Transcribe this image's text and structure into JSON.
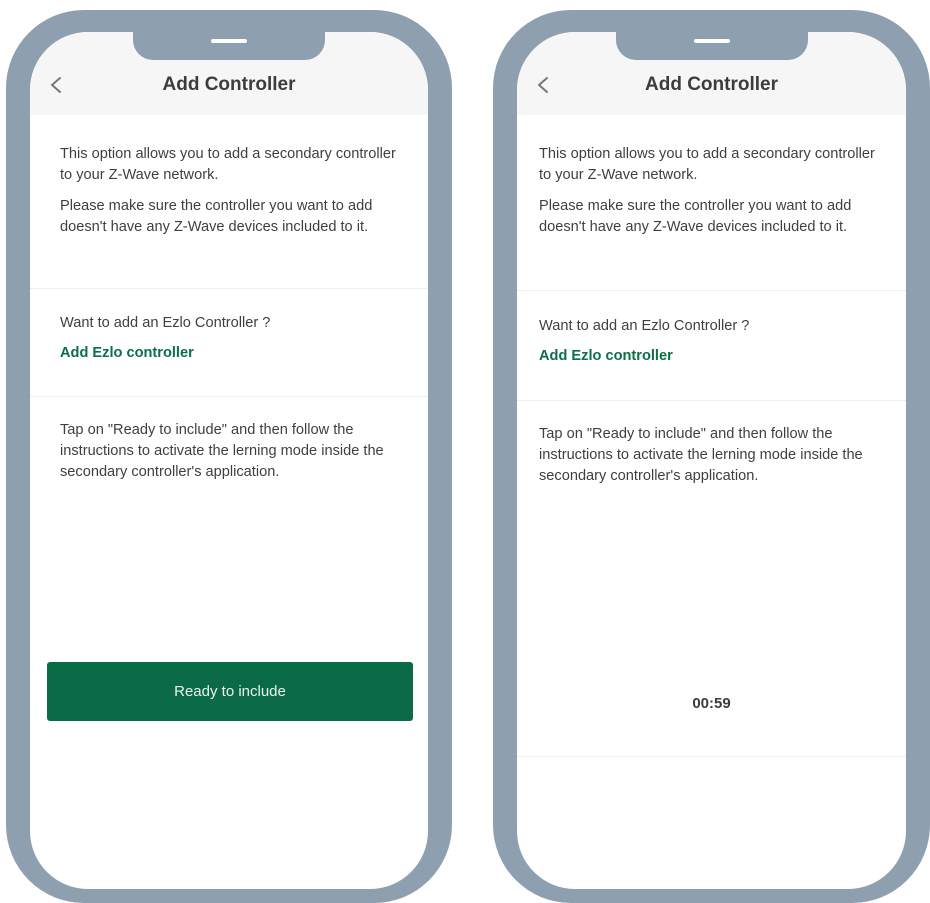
{
  "screens": [
    {
      "title": "Add Controller",
      "intro": [
        "This option allows you to add a secondary controller to your Z-Wave network.",
        "Please make sure  the controller you want to add doesn't have any Z-Wave devices included to it."
      ],
      "ezlo_question": "Want to add an Ezlo Controller ?",
      "ezlo_link": "Add Ezlo controller",
      "instructions": "Tap on \"Ready to include\" and then follow the instructions to activate the lerning mode inside the secondary controller's application.",
      "ready_button": "Ready to include"
    },
    {
      "title": "Add Controller",
      "intro": [
        "This option allows you to add a secondary controller to your Z-Wave network.",
        "Please make sure  the controller you want to add doesn't have any Z-Wave devices included to it."
      ],
      "ezlo_question": "Want to add an Ezlo Controller ?",
      "ezlo_link": "Add Ezlo controller",
      "instructions": "Tap on \"Ready to include\" and then follow the instructions to activate the lerning mode inside the secondary controller's application.",
      "countdown": "00:59"
    }
  ],
  "icons": {
    "back": "chevron-left-icon"
  },
  "colors": {
    "accent": "#0b6b46",
    "link": "#0d6e47",
    "frame": "#8e9fb0",
    "header": "#f6f6f6"
  }
}
